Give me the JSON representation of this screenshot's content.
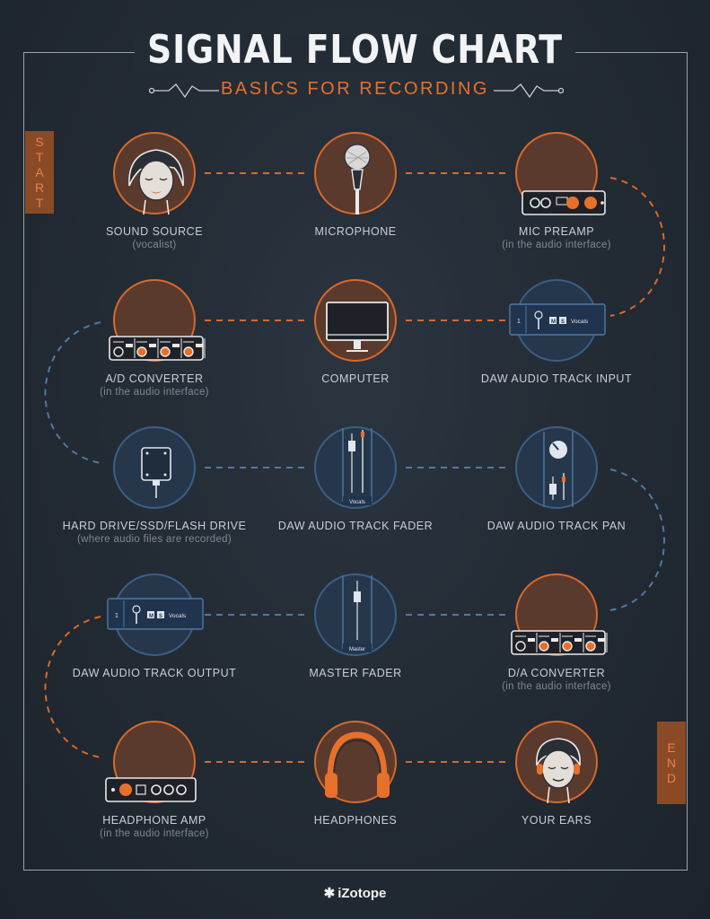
{
  "header": {
    "title": "SIGNAL FLOW CHART",
    "subtitle": "BASICS FOR RECORDING"
  },
  "start_tab": "START",
  "end_tab": "END",
  "colors": {
    "orange": "#d8692a",
    "blue": "#3b5f85",
    "background": "#232b34"
  },
  "nodes": [
    {
      "label": "SOUND SOURCE",
      "sub": "(vocalist)",
      "icon": "vocalist-face-icon"
    },
    {
      "label": "MICROPHONE",
      "sub": "",
      "icon": "microphone-icon"
    },
    {
      "label": "MIC PREAMP",
      "sub": "(in the audio interface)",
      "icon": "preamp-icon"
    },
    {
      "label": "DAW AUDIO TRACK INPUT",
      "sub": "",
      "icon": "track-strip-icon"
    },
    {
      "label": "COMPUTER",
      "sub": "",
      "icon": "monitor-icon"
    },
    {
      "label": "A/D CONVERTER",
      "sub": "(in the audio interface)",
      "icon": "converter-icon"
    },
    {
      "label": "HARD DRIVE/SSD/FLASH DRIVE",
      "sub": "(where audio files are recorded)",
      "icon": "drive-icon"
    },
    {
      "label": "DAW AUDIO TRACK FADER",
      "sub": "",
      "icon": "fader-icon"
    },
    {
      "label": "DAW AUDIO TRACK PAN",
      "sub": "",
      "icon": "pan-knob-icon"
    },
    {
      "label": "D/A CONVERTER",
      "sub": "(in the audio interface)",
      "icon": "converter-icon"
    },
    {
      "label": "MASTER FADER",
      "sub": "",
      "icon": "fader-icon"
    },
    {
      "label": "DAW AUDIO TRACK OUTPUT",
      "sub": "",
      "icon": "track-strip-icon"
    },
    {
      "label": "HEADPHONE AMP",
      "sub": "(in the audio interface)",
      "icon": "headphone-amp-icon"
    },
    {
      "label": "HEADPHONES",
      "sub": "",
      "icon": "headphones-icon"
    },
    {
      "label": "YOUR EARS",
      "sub": "",
      "icon": "listener-face-icon"
    }
  ],
  "track_strip": {
    "number": "1",
    "mute": "M",
    "solo": "S",
    "name": "Vocals"
  },
  "fader_labels": {
    "track": "Vocals",
    "master": "Master"
  },
  "brand": "iZotope"
}
